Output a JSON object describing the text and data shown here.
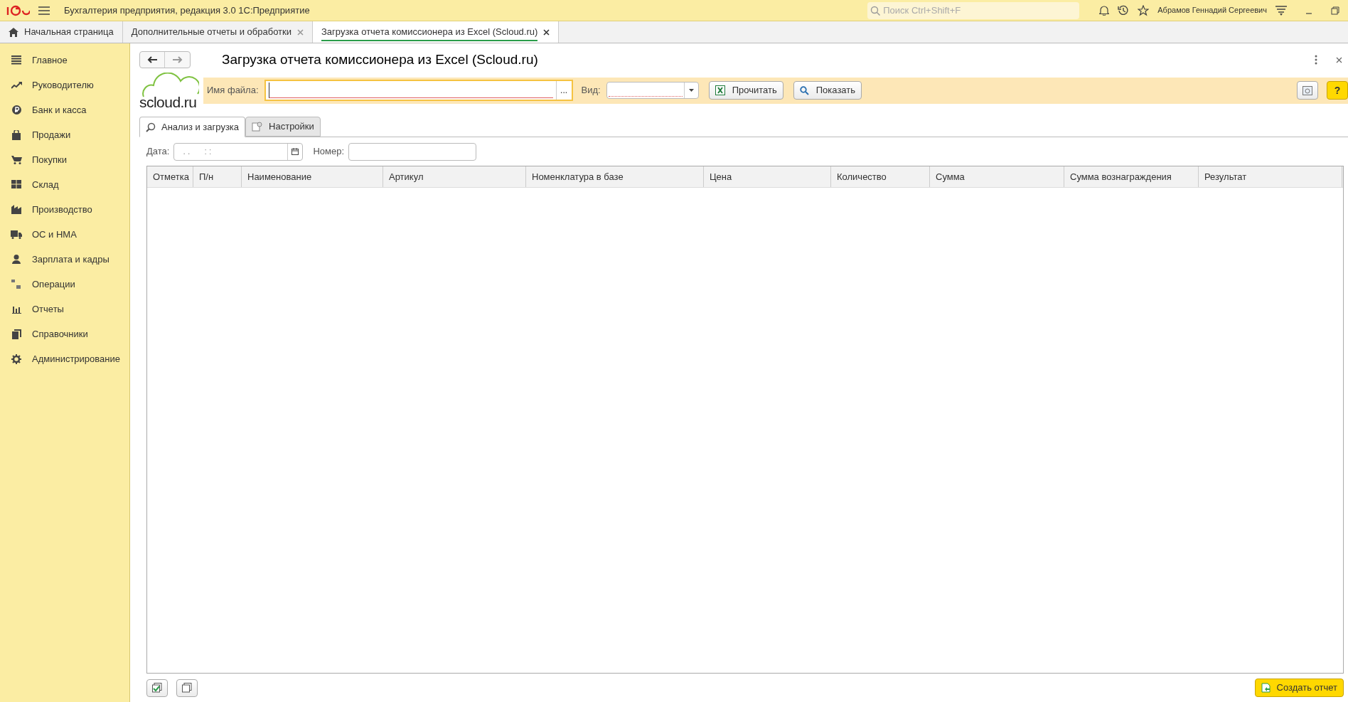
{
  "app_title": "Бухгалтерия предприятия, редакция 3.0 1С:Предприятие",
  "search": {
    "placeholder": "Поиск Ctrl+Shift+F"
  },
  "user": "Абрамов Геннадий Сергеевич",
  "tabs": [
    {
      "label": "Начальная страница",
      "selected": false,
      "closable": false
    },
    {
      "label": "Дополнительные отчеты и обработки",
      "selected": false,
      "closable": true
    },
    {
      "label": "Загрузка отчета комиссионера из Excel (Scloud.ru)",
      "selected": true,
      "closable": true
    }
  ],
  "sidebar": {
    "items": [
      {
        "label": "Главное"
      },
      {
        "label": "Руководителю"
      },
      {
        "label": "Банк и касса"
      },
      {
        "label": "Продажи"
      },
      {
        "label": "Покупки"
      },
      {
        "label": "Склад"
      },
      {
        "label": "Производство"
      },
      {
        "label": "ОС и НМА"
      },
      {
        "label": "Зарплата и кадры"
      },
      {
        "label": "Операции"
      },
      {
        "label": "Отчеты"
      },
      {
        "label": "Справочники"
      },
      {
        "label": "Администрирование"
      }
    ]
  },
  "form": {
    "title": "Загрузка отчета комиссионера из Excel (Scloud.ru)",
    "logo": "scloud.ru",
    "file_label": "Имя файла:",
    "file_button": "...",
    "kind_label": "Вид:",
    "buttons": [
      "Прочитать",
      "Показать"
    ],
    "help_button": "?",
    "subtabs": [
      {
        "label": "Анализ и загрузка",
        "selected": true
      },
      {
        "label": "Настройки",
        "selected": false
      }
    ],
    "date_label": "Дата:",
    "date_mask": ". .      : :",
    "number_label": "Номер:",
    "table": {
      "columns": [
        "Отметка",
        "П/н",
        "Наименование",
        "Артикул",
        "Номенклатура в базе",
        "Цена",
        "Количество",
        "Сумма",
        "Сумма вознаграждения",
        "Результат"
      ]
    },
    "create_button": "Создать отчет"
  }
}
